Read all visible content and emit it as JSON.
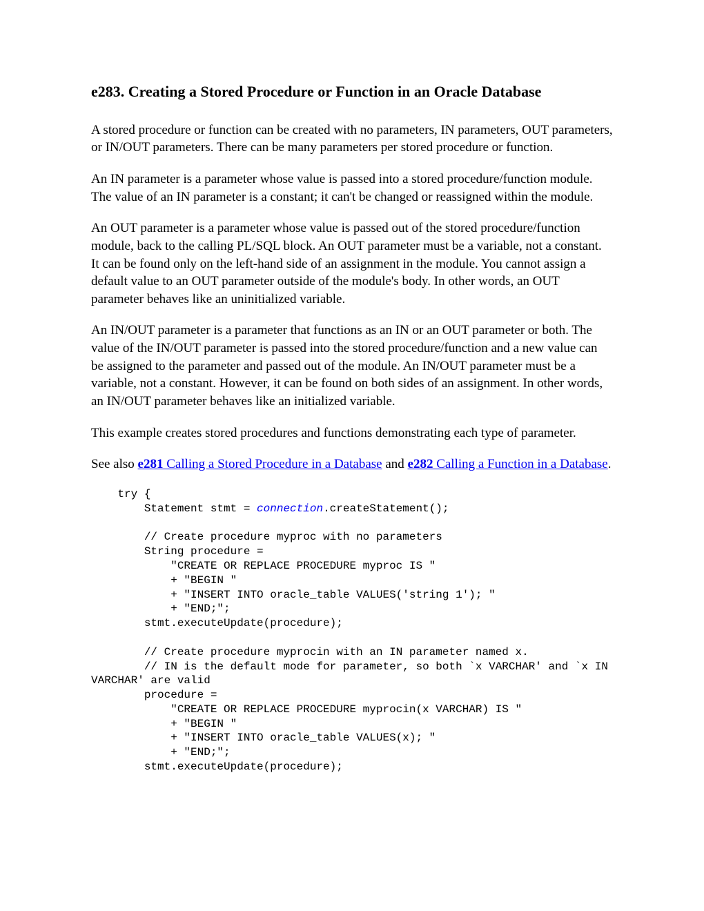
{
  "heading": "e283. Creating a Stored Procedure or Function in an Oracle Database",
  "paras": {
    "p1": "A stored procedure or function can be created with no parameters, IN parameters, OUT parameters, or IN/OUT parameters. There can be many parameters per stored procedure or function.",
    "p2": "An IN parameter is a parameter whose value is passed into a stored procedure/function module. The value of an IN parameter is a constant; it can't be changed or reassigned within the module.",
    "p3": "An OUT parameter is a parameter whose value is passed out of the stored procedure/function module, back to the calling PL/SQL block. An OUT parameter must be a variable, not a constant. It can be found only on the left-hand side of an assignment in the module. You cannot assign a default value to an OUT parameter outside of the module's body. In other words, an OUT parameter behaves like an uninitialized variable.",
    "p4": "An IN/OUT parameter is a parameter that functions as an IN or an OUT parameter or both. The value of the IN/OUT parameter is passed into the stored procedure/function and a new value can be assigned to the parameter and passed out of the module. An IN/OUT parameter must be a variable, not a constant. However, it can be found on both sides of an assignment. In other words, an IN/OUT parameter behaves like an initialized variable.",
    "p5": "This example creates stored procedures and functions demonstrating each type of parameter."
  },
  "seealso": {
    "prefix": "See also ",
    "link1_lead": "e281",
    "link1_rest": " Calling a Stored Procedure in a Database",
    "mid": " and ",
    "link2_lead": "e282",
    "link2_rest": " Calling a Function in a Database",
    "suffix": "."
  },
  "code": {
    "l01": "    try {",
    "l02": "        Statement stmt = ",
    "l02_ital": "connection",
    "l02b": ".createStatement();",
    "blank1": "",
    "l03": "        // Create procedure myproc with no parameters",
    "l04": "        String procedure =",
    "l05": "            \"CREATE OR REPLACE PROCEDURE myproc IS \"",
    "l06": "            + \"BEGIN \"",
    "l07": "            + \"INSERT INTO oracle_table VALUES('string 1'); \"",
    "l08": "            + \"END;\";",
    "l09": "        stmt.executeUpdate(procedure);",
    "blank2": "",
    "l10": "        // Create procedure myprocin with an IN parameter named x.",
    "l11": "        // IN is the default mode for parameter, so both `x VARCHAR' and `x IN VARCHAR' are valid",
    "l12": "        procedure =",
    "l13": "            \"CREATE OR REPLACE PROCEDURE myprocin(x VARCHAR) IS \"",
    "l14": "            + \"BEGIN \"",
    "l15": "            + \"INSERT INTO oracle_table VALUES(x); \"",
    "l16": "            + \"END;\";",
    "l17": "        stmt.executeUpdate(procedure);"
  }
}
